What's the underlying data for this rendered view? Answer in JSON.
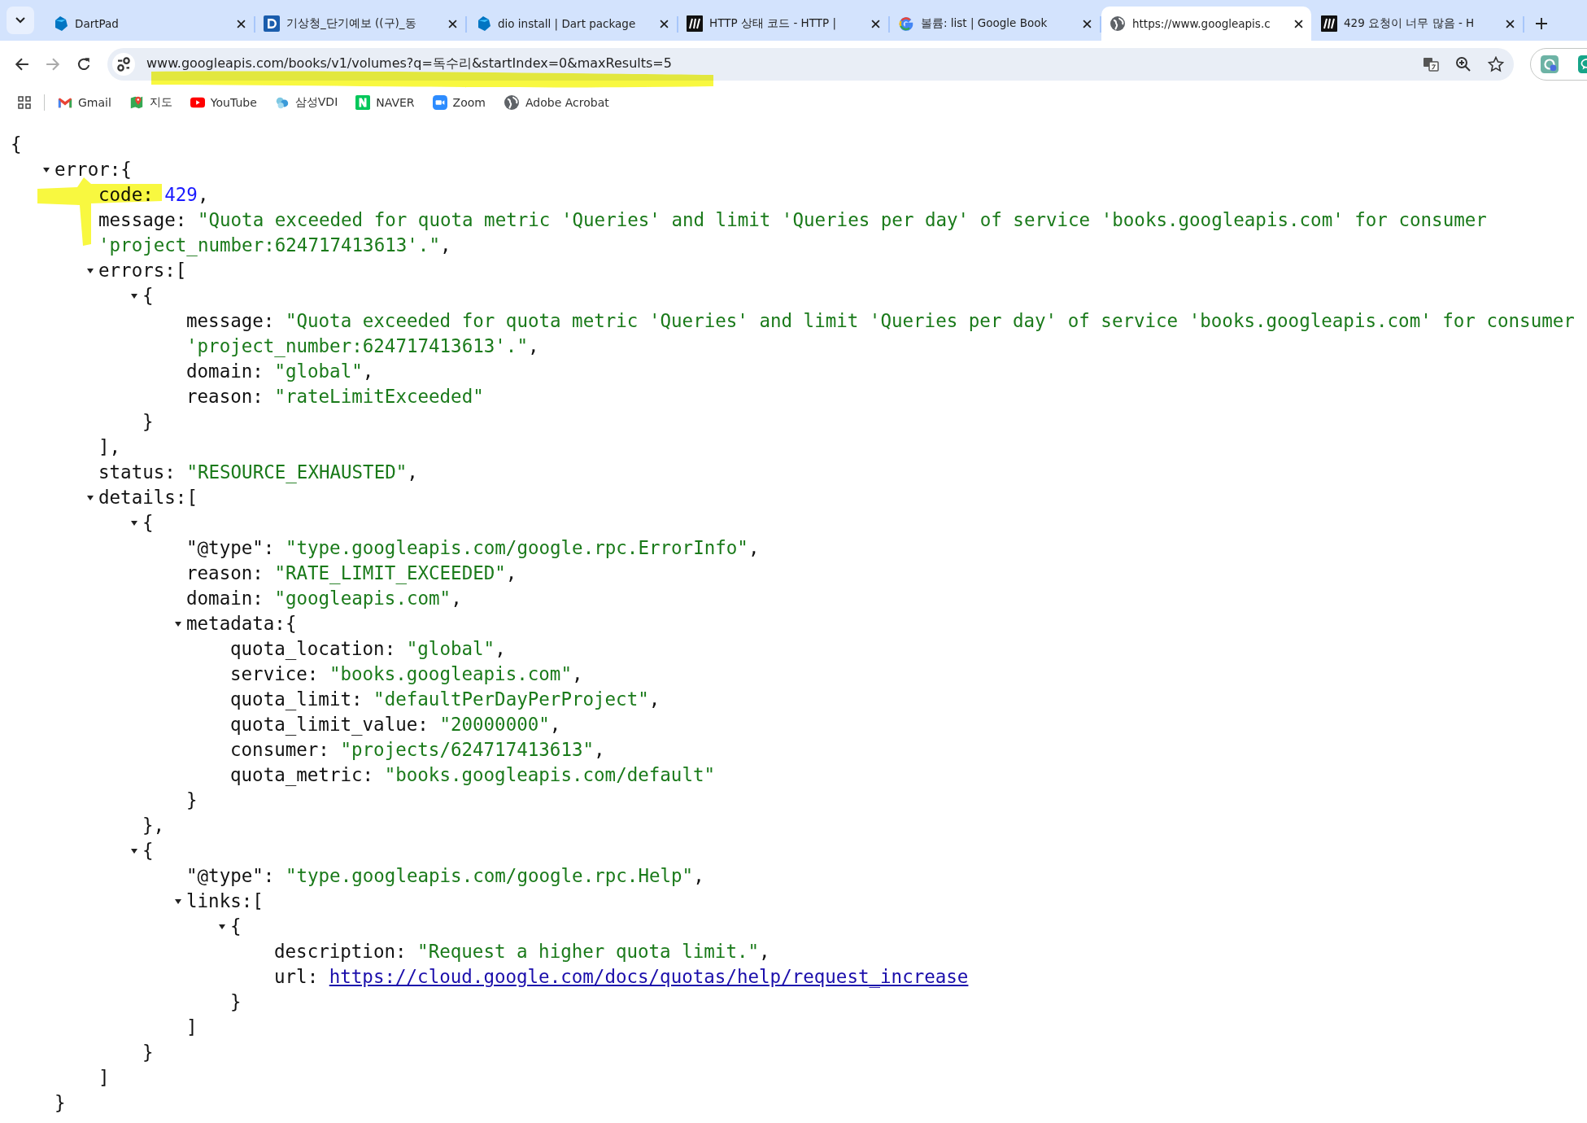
{
  "tabs": [
    {
      "title": "DartPad",
      "kind": "dart",
      "selected": false
    },
    {
      "title": "기상청_단기예보 ((구)_동",
      "kind": "square-d",
      "selected": false
    },
    {
      "title": "dio install | Dart package",
      "kind": "dart",
      "selected": false
    },
    {
      "title": "HTTP 상태 코드 - HTTP |",
      "kind": "square-m",
      "selected": false
    },
    {
      "title": "볼륨: list  |  Google Book",
      "kind": "google",
      "selected": false
    },
    {
      "title": "https://www.googleapis.c",
      "kind": "globe",
      "selected": true
    },
    {
      "title": "429 요청이 너무 많음 - H",
      "kind": "square-m",
      "selected": false
    }
  ],
  "address_bar": {
    "url": "www.googleapis.com/books/v1/volumes?q=독수리&startIndex=0&maxResults=5"
  },
  "bookmarks": [
    {
      "label": "Gmail",
      "kind": "gmail"
    },
    {
      "label": "지도",
      "kind": "map"
    },
    {
      "label": "YouTube",
      "kind": "youtube"
    },
    {
      "label": "삼성VDI",
      "kind": "cloud"
    },
    {
      "label": "NAVER",
      "kind": "naver"
    },
    {
      "label": "Zoom",
      "kind": "zoom"
    },
    {
      "label": "Adobe Acrobat",
      "kind": "globe"
    }
  ],
  "json_view": {
    "open": "{",
    "children": [
      {
        "kind": "object",
        "key": "error:",
        "open": "{",
        "expanded": true,
        "close": "}",
        "children": [
          {
            "kind": "number",
            "key": "code:",
            "value": "429",
            "after": ","
          },
          {
            "kind": "string",
            "key": "message:",
            "value": "\"Quota exceeded for quota metric 'Queries' and limit 'Queries per day' of service 'books.googleapis.com' for consumer 'project_number:624717413613'.\"",
            "after": ","
          },
          {
            "kind": "array",
            "key": "errors:",
            "open": "[",
            "expanded": true,
            "close": "],",
            "children": [
              {
                "kind": "object",
                "open": "{",
                "expanded": true,
                "close": "}",
                "children": [
                  {
                    "kind": "string",
                    "key": "message:",
                    "value": "\"Quota exceeded for quota metric 'Queries' and limit 'Queries per day' of service 'books.googleapis.com' for consumer 'project_number:624717413613'.\"",
                    "after": ","
                  },
                  {
                    "kind": "string",
                    "key": "domain:",
                    "value": "\"global\"",
                    "after": ","
                  },
                  {
                    "kind": "string",
                    "key": "reason:",
                    "value": "\"rateLimitExceeded\""
                  }
                ]
              }
            ]
          },
          {
            "kind": "string",
            "key": "status:",
            "value": "\"RESOURCE_EXHAUSTED\"",
            "after": ","
          },
          {
            "kind": "array",
            "key": "details:",
            "open": "[",
            "expanded": true,
            "close": "]",
            "children": [
              {
                "kind": "object",
                "open": "{",
                "expanded": true,
                "close": "},",
                "children": [
                  {
                    "kind": "string",
                    "key": "\"@type\":",
                    "value": "\"type.googleapis.com/google.rpc.ErrorInfo\"",
                    "after": ","
                  },
                  {
                    "kind": "string",
                    "key": "reason:",
                    "value": "\"RATE_LIMIT_EXCEEDED\"",
                    "after": ","
                  },
                  {
                    "kind": "string",
                    "key": "domain:",
                    "value": "\"googleapis.com\"",
                    "after": ","
                  },
                  {
                    "kind": "object",
                    "key": "metadata:",
                    "open": "{",
                    "expanded": true,
                    "close": "}",
                    "children": [
                      {
                        "kind": "string",
                        "key": "quota_location:",
                        "value": "\"global\"",
                        "after": ","
                      },
                      {
                        "kind": "string",
                        "key": "service:",
                        "value": "\"books.googleapis.com\"",
                        "after": ","
                      },
                      {
                        "kind": "string",
                        "key": "quota_limit:",
                        "value": "\"defaultPerDayPerProject\"",
                        "after": ","
                      },
                      {
                        "kind": "string",
                        "key": "quota_limit_value:",
                        "value": "\"20000000\"",
                        "after": ","
                      },
                      {
                        "kind": "string",
                        "key": "consumer:",
                        "value": "\"projects/624717413613\"",
                        "after": ","
                      },
                      {
                        "kind": "string",
                        "key": "quota_metric:",
                        "value": "\"books.googleapis.com/default\""
                      }
                    ]
                  }
                ]
              },
              {
                "kind": "object",
                "open": "{",
                "expanded": true,
                "close": "}",
                "children": [
                  {
                    "kind": "string",
                    "key": "\"@type\":",
                    "value": "\"type.googleapis.com/google.rpc.Help\"",
                    "after": ","
                  },
                  {
                    "kind": "array",
                    "key": "links:",
                    "open": "[",
                    "expanded": true,
                    "close": "]",
                    "children": [
                      {
                        "kind": "object",
                        "open": "{",
                        "expanded": true,
                        "close": "}",
                        "children": [
                          {
                            "kind": "string",
                            "key": "description:",
                            "value": "\"Request a higher quota limit.\"",
                            "after": ","
                          },
                          {
                            "kind": "link",
                            "key": "url:",
                            "value": "https://cloud.google.com/docs/quotas/help/request_increase"
                          }
                        ]
                      }
                    ]
                  }
                ]
              }
            ]
          }
        ]
      }
    ]
  }
}
